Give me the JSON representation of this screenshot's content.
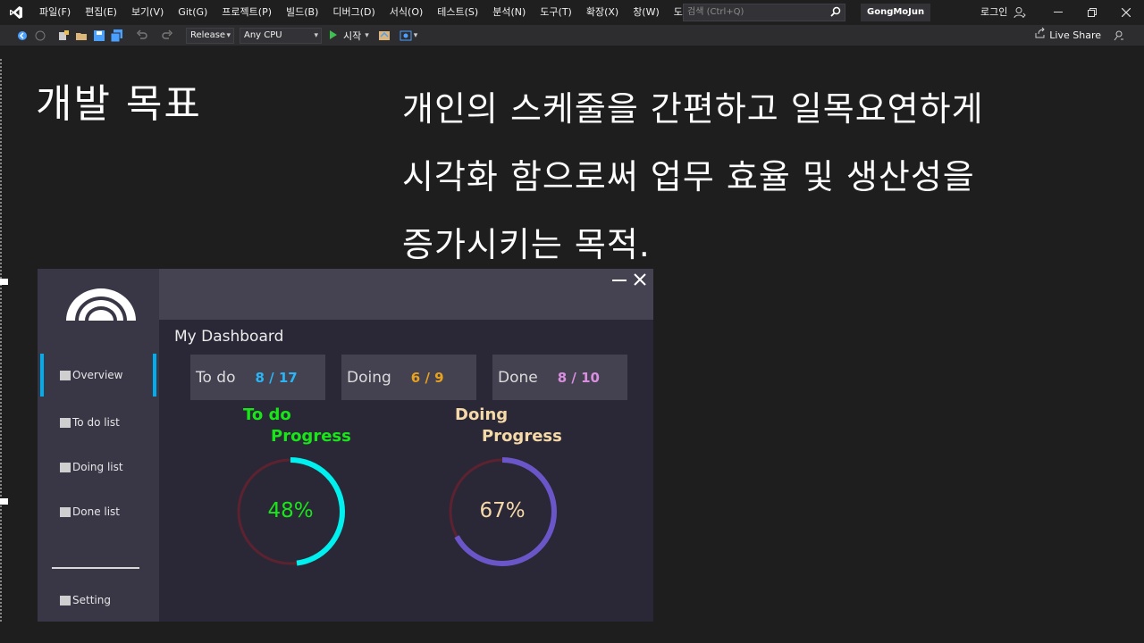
{
  "vs": {
    "menu": [
      "파일(F)",
      "편집(E)",
      "보기(V)",
      "Git(G)",
      "프로젝트(P)",
      "빌드(B)",
      "디버그(D)",
      "서식(O)",
      "테스트(S)",
      "분석(N)",
      "도구(T)",
      "확장(X)",
      "창(W)",
      "도움말(H)"
    ],
    "search_placeholder": "검색 (Ctrl+Q)",
    "project_name": "GongMoJun",
    "login_label": "로그인",
    "config": "Release",
    "platform": "Any CPU",
    "start_label": "시작",
    "live_share": "Live Share"
  },
  "slide": {
    "title": "개발 목표",
    "body_lines": [
      "개인의 스케줄을 간편하고 일목요연하게",
      "시각화 함으로써 업무 효율 및 생산성을",
      "증가시키는 목적."
    ]
  },
  "dashboard": {
    "nav": [
      "Overview",
      "To do list",
      "Doing list",
      "Done list",
      "Setting"
    ],
    "title": "My Dashboard",
    "stats": [
      {
        "label": "To do",
        "value": "8 / 17",
        "color": "#29b6f6"
      },
      {
        "label": "Doing",
        "value": "6 / 9",
        "color": "#e8a21c"
      },
      {
        "label": "Done",
        "value": "8 / 10",
        "color": "#d98ee0"
      }
    ],
    "progress": [
      {
        "line1": "To do",
        "line2": "Progress",
        "title_color": "#19e619",
        "percent": 48,
        "text": "48%",
        "text_color": "#19e619",
        "ring_color": "#00f0f0",
        "track_color": "#5c2230"
      },
      {
        "line1": "Doing",
        "line2": "Progress",
        "title_color": "#f5d9a8",
        "percent": 67,
        "text": "67%",
        "text_color": "#f5d9a8",
        "ring_color": "#6a56c8",
        "track_color": "#5c2230"
      }
    ]
  }
}
